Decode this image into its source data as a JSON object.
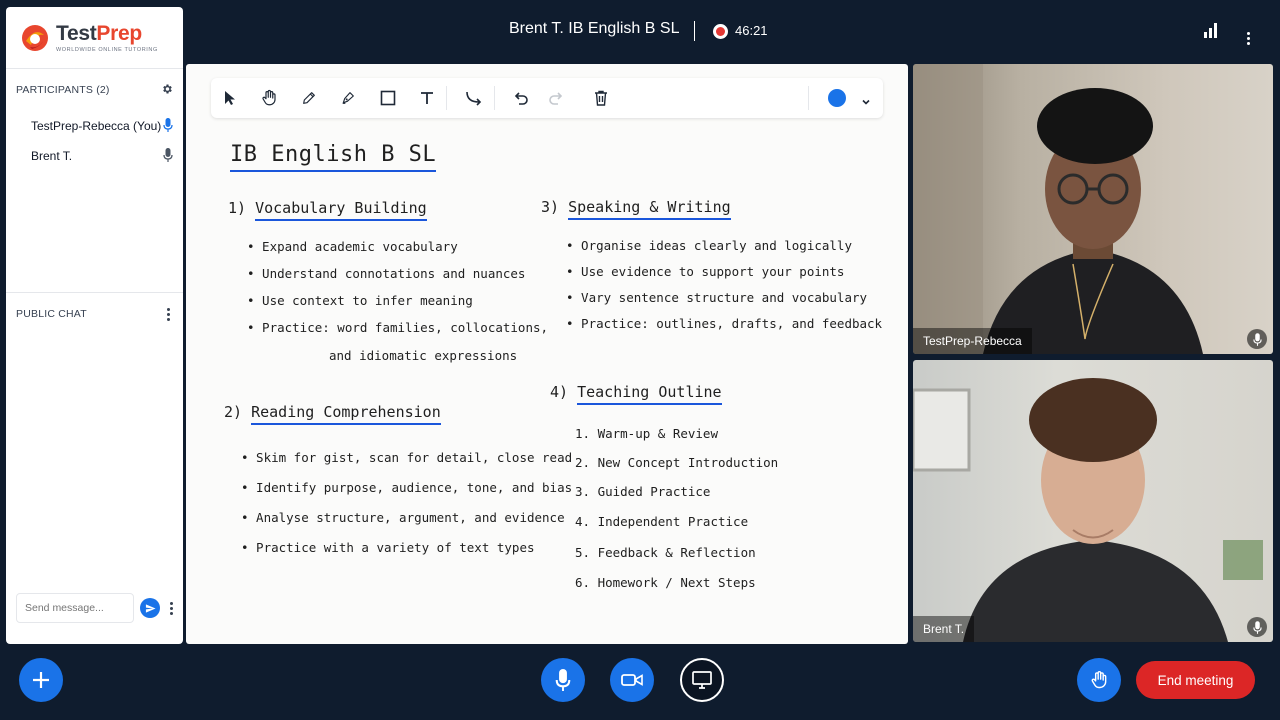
{
  "brand": {
    "name_part1": "Test",
    "name_part2": "Prep",
    "tagline": "WORLDWIDE  ONLINE  TUTORING"
  },
  "participants": {
    "header": "PARTICIPANTS (2)",
    "list": [
      {
        "name": "TestPrep-Rebecca (You)",
        "mic_active": true
      },
      {
        "name": "Brent T.",
        "mic_active": false
      }
    ]
  },
  "chat": {
    "header": "PUBLIC CHAT",
    "input_placeholder": "Send message..."
  },
  "meeting": {
    "title": "Brent T. IB English B SL",
    "recording_time": "46:21"
  },
  "toolbar": {
    "tools": [
      "pointer-icon",
      "hand-icon",
      "pencil-icon",
      "marker-icon",
      "rectangle-icon",
      "text-icon",
      "connector-icon",
      "undo-icon",
      "redo-icon",
      "trash-icon"
    ],
    "selected_color": "#1a73e8"
  },
  "whiteboard": {
    "title": "IB English B SL",
    "section1": {
      "num": "1)",
      "heading": "Vocabulary Building",
      "items": [
        "• Expand academic vocabulary",
        "• Understand connotations and nuances",
        "• Use context to infer meaning",
        "• Practice: word families, collocations,",
        "and idiomatic expressions"
      ]
    },
    "section2": {
      "num": "2)",
      "heading": "Reading Comprehension",
      "items": [
        "• Skim for gist, scan for detail, close read",
        "• Identify purpose, audience, tone, and bias",
        "• Analyse structure, argument, and evidence",
        "• Practice with a variety of text types"
      ]
    },
    "section3": {
      "num": "3)",
      "heading": "Speaking & Writing",
      "items": [
        "• Organise ideas clearly and logically",
        "• Use evidence to support your points",
        "• Vary sentence structure and vocabulary",
        "• Practice: outlines, drafts, and feedback"
      ]
    },
    "section4": {
      "num": "4)",
      "heading": "Teaching Outline",
      "items": [
        "1.  Warm-up & Review",
        "2.  New Concept Introduction",
        "3.  Guided Practice",
        "4.  Independent Practice",
        "5.  Feedback & Reflection",
        "6.  Homework / Next Steps"
      ]
    }
  },
  "videos": [
    {
      "name": "TestPrep-Rebecca"
    },
    {
      "name": "Brent T."
    }
  ],
  "controls": {
    "end_label": "End meeting",
    "accent": "#1a73e8",
    "danger": "#dc2626"
  }
}
